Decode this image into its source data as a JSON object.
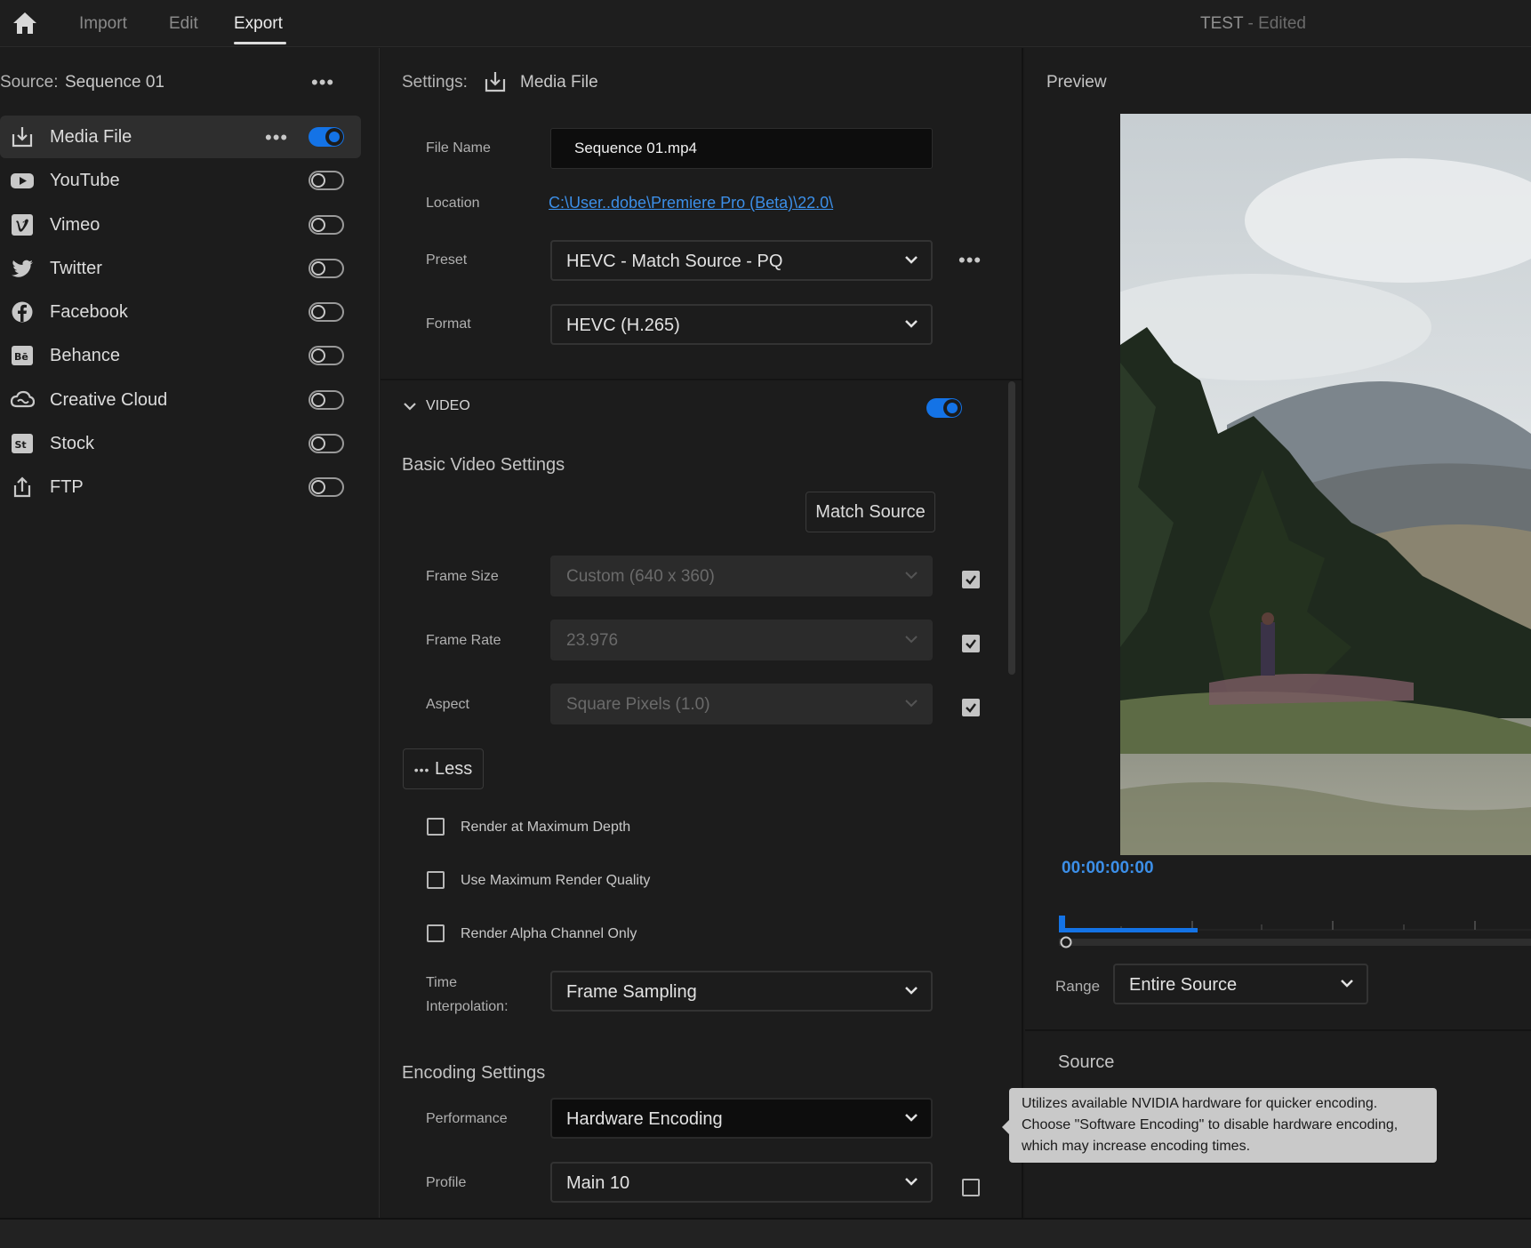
{
  "topbar": {
    "tabs": [
      "Import",
      "Edit",
      "Export"
    ],
    "active_tab": "Export",
    "project_name": "TEST",
    "project_status": " - Edited"
  },
  "source_panel": {
    "label": "Source:",
    "name": "Sequence 01",
    "destinations": [
      {
        "label": "Media File",
        "icon": "media-file-icon",
        "enabled": true
      },
      {
        "label": "YouTube",
        "icon": "youtube-icon",
        "enabled": false
      },
      {
        "label": "Vimeo",
        "icon": "vimeo-icon",
        "enabled": false
      },
      {
        "label": "Twitter",
        "icon": "twitter-icon",
        "enabled": false
      },
      {
        "label": "Facebook",
        "icon": "facebook-icon",
        "enabled": false
      },
      {
        "label": "Behance",
        "icon": "behance-icon",
        "enabled": false
      },
      {
        "label": "Creative Cloud",
        "icon": "creative-cloud-icon",
        "enabled": false
      },
      {
        "label": "Stock",
        "icon": "stock-icon",
        "enabled": false
      },
      {
        "label": "FTP",
        "icon": "ftp-icon",
        "enabled": false
      }
    ]
  },
  "settings": {
    "label": "Settings:",
    "target": "Media File",
    "file_name_label": "File Name",
    "file_name": "Sequence 01.mp4",
    "location_label": "Location",
    "location": "C:\\User..dobe\\Premiere Pro (Beta)\\22.0\\",
    "preset_label": "Preset",
    "preset": "HEVC - Match Source - PQ",
    "format_label": "Format",
    "format": "HEVC (H.265)"
  },
  "video": {
    "section_label": "VIDEO",
    "enabled": true,
    "basic_heading": "Basic Video Settings",
    "match_source_button": "Match Source",
    "frame_size_label": "Frame Size",
    "frame_size": "Custom (640 x 360)",
    "frame_size_checked": true,
    "frame_rate_label": "Frame Rate",
    "frame_rate": "23.976",
    "frame_rate_checked": true,
    "aspect_label": "Aspect",
    "aspect": "Square Pixels (1.0)",
    "aspect_checked": true,
    "less_button": "Less",
    "options": [
      {
        "label": "Render at Maximum Depth",
        "checked": false
      },
      {
        "label": "Use Maximum Render Quality",
        "checked": false
      },
      {
        "label": "Render Alpha Channel Only",
        "checked": false
      }
    ],
    "time_interp_label_1": "Time",
    "time_interp_label_2": "Interpolation:",
    "time_interpolation": "Frame Sampling"
  },
  "encoding": {
    "heading": "Encoding Settings",
    "performance_label": "Performance",
    "performance": "Hardware Encoding",
    "profile_label": "Profile",
    "profile": "Main 10",
    "profile_checked": false
  },
  "preview": {
    "title": "Preview",
    "timecode": "00:00:00:00",
    "playhead_fraction": 0.0,
    "range_label": "Range",
    "range": "Entire Source",
    "source_heading": "Source"
  },
  "tooltip": {
    "text": "Utilizes available NVIDIA hardware for quicker encoding. Choose \"Software Encoding\" to disable hardware encoding, which may increase encoding times."
  },
  "colors": {
    "accent": "#1473e6",
    "link": "#3c8fe8",
    "background": "#1c1c1c"
  }
}
